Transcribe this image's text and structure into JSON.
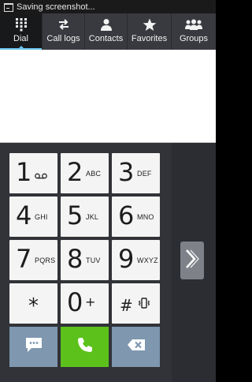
{
  "status": {
    "text": "Saving screenshot..."
  },
  "tabs": [
    {
      "label": "Dial",
      "icon": "dialpad-icon",
      "active": true
    },
    {
      "label": "Call logs",
      "icon": "call-logs-icon",
      "active": false
    },
    {
      "label": "Contacts",
      "icon": "contact-icon",
      "active": false
    },
    {
      "label": "Favorites",
      "icon": "star-icon",
      "active": false
    },
    {
      "label": "Groups",
      "icon": "groups-icon",
      "active": false
    }
  ],
  "number_field": {
    "value": ""
  },
  "keys": [
    {
      "digit": "1",
      "sub": "voicemail"
    },
    {
      "digit": "2",
      "sub": "ABC"
    },
    {
      "digit": "3",
      "sub": "DEF"
    },
    {
      "digit": "4",
      "sub": "GHI"
    },
    {
      "digit": "5",
      "sub": "JKL"
    },
    {
      "digit": "6",
      "sub": "MNO"
    },
    {
      "digit": "7",
      "sub": "PQRS"
    },
    {
      "digit": "8",
      "sub": "TUV"
    },
    {
      "digit": "9",
      "sub": "WXYZ"
    },
    {
      "digit": "*",
      "sub": ""
    },
    {
      "digit": "0",
      "sub": "+"
    },
    {
      "digit": "#",
      "sub": "vibrate"
    }
  ],
  "actions": {
    "message": "message-icon",
    "call": "phone-icon",
    "delete": "backspace-icon"
  },
  "colors": {
    "call": "#5cc21b",
    "action_keys": "#7f97af",
    "accent": "#6cc6ee"
  }
}
